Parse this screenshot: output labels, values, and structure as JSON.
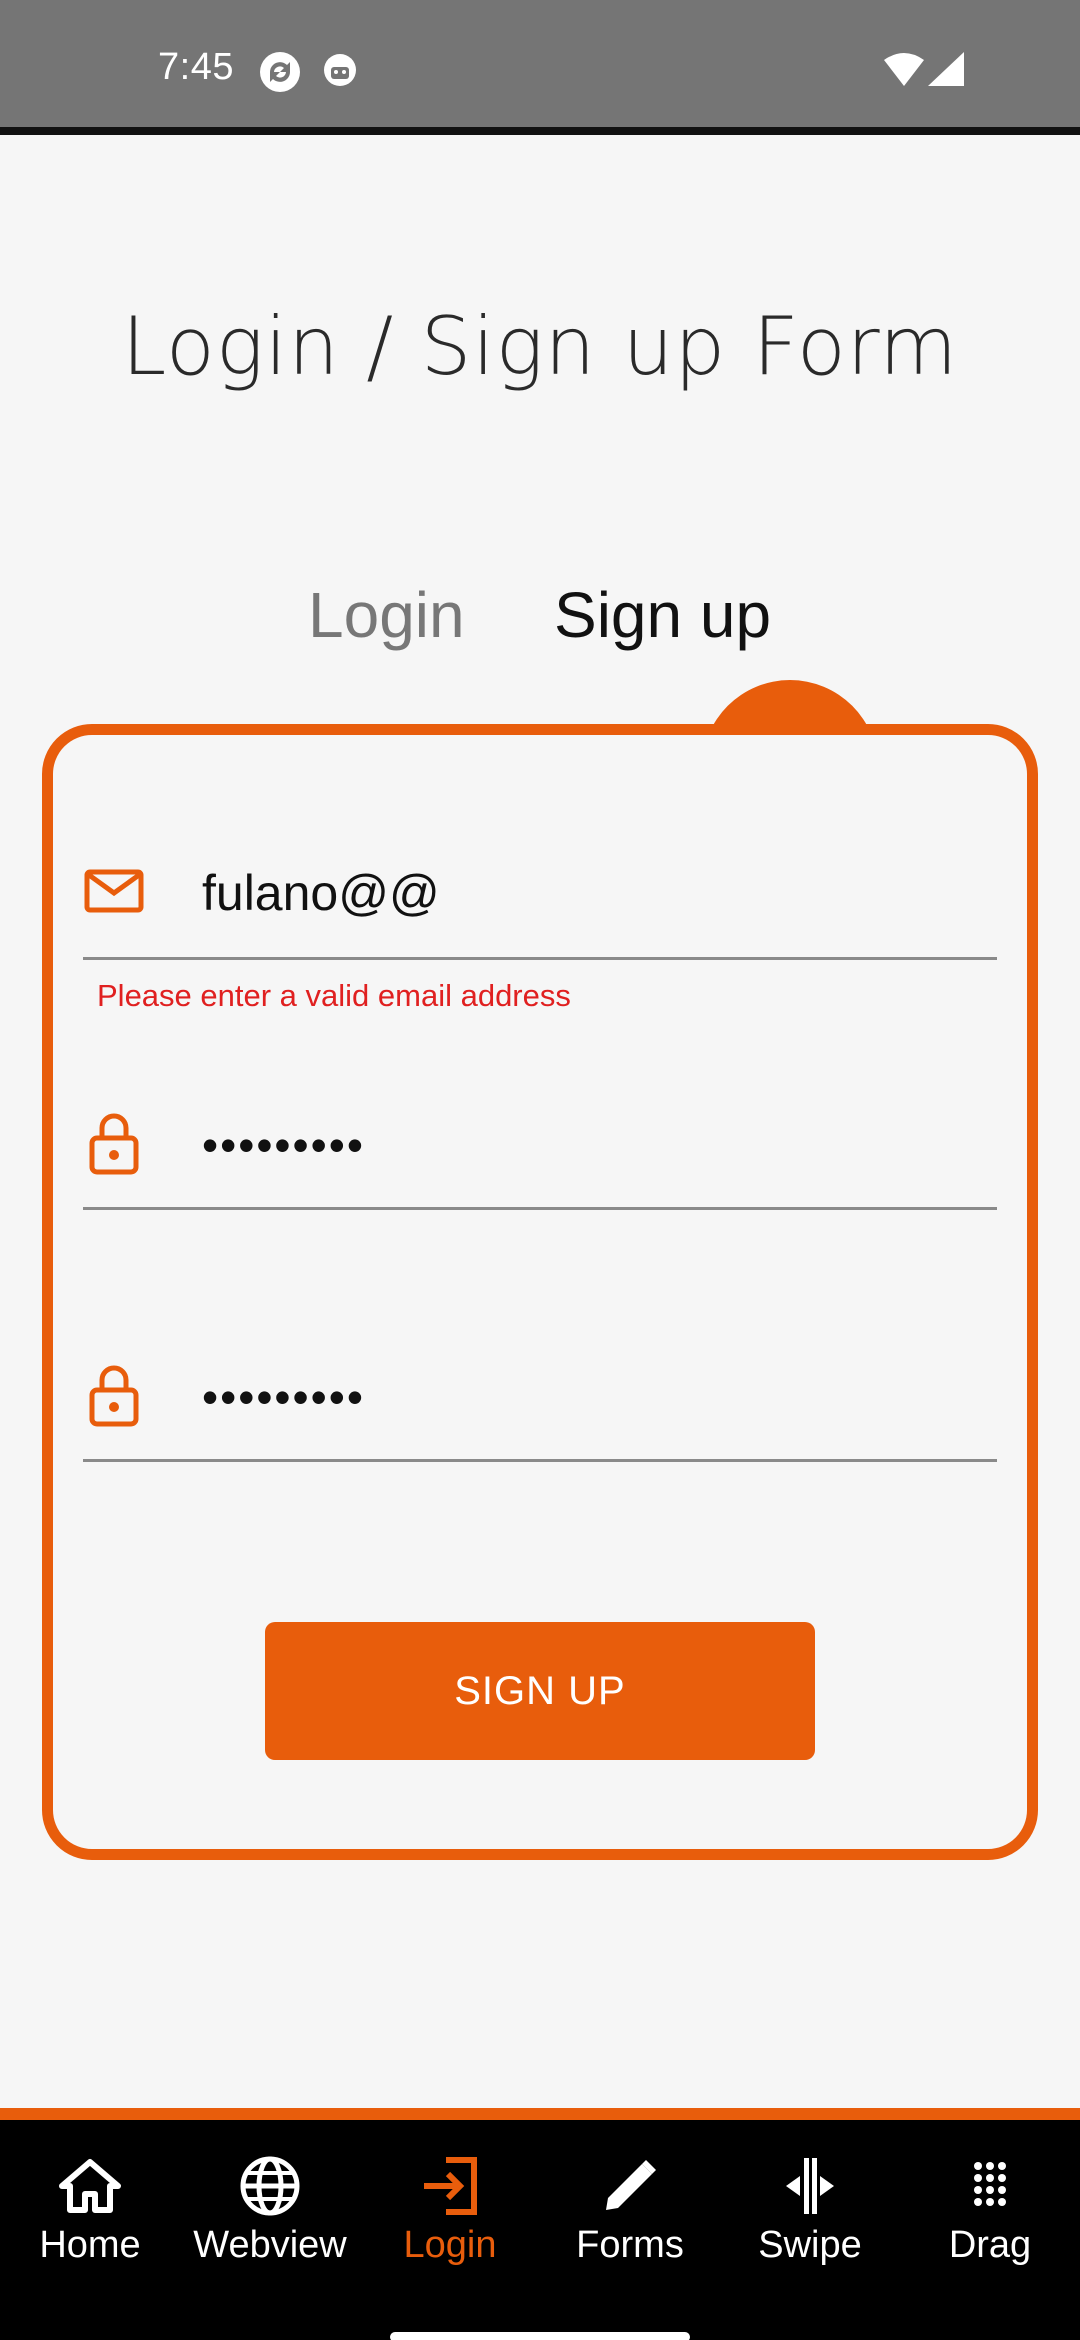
{
  "status_bar": {
    "time": "7:45",
    "icons": [
      "sync-icon",
      "android-debug-icon",
      "wifi-icon",
      "signal-icon"
    ]
  },
  "page": {
    "title": "Login / Sign up Form"
  },
  "tabs": [
    {
      "label": "Login",
      "active": false
    },
    {
      "label": "Sign up",
      "active": true
    }
  ],
  "form": {
    "email": {
      "value": "fulano@@",
      "icon": "mail-icon",
      "error": "Please enter a valid email address"
    },
    "password": {
      "value": "•••••••••",
      "icon": "lock-icon"
    },
    "confirm_password": {
      "value": "•••••••••",
      "icon": "lock-icon"
    },
    "submit_label": "SIGN UP"
  },
  "bottom_nav": {
    "items": [
      {
        "label": "Home",
        "icon": "home-icon",
        "active": false
      },
      {
        "label": "Webview",
        "icon": "globe-icon",
        "active": false
      },
      {
        "label": "Login",
        "icon": "login-icon",
        "active": true
      },
      {
        "label": "Forms",
        "icon": "pencil-icon",
        "active": false
      },
      {
        "label": "Swipe",
        "icon": "swipe-icon",
        "active": false
      },
      {
        "label": "Drag",
        "icon": "drag-grid-icon",
        "active": false
      }
    ]
  },
  "colors": {
    "accent": "#e85d0c",
    "background": "#f6f6f6",
    "status_bar": "#757575",
    "error": "#e02020",
    "nav_background": "#000000"
  }
}
